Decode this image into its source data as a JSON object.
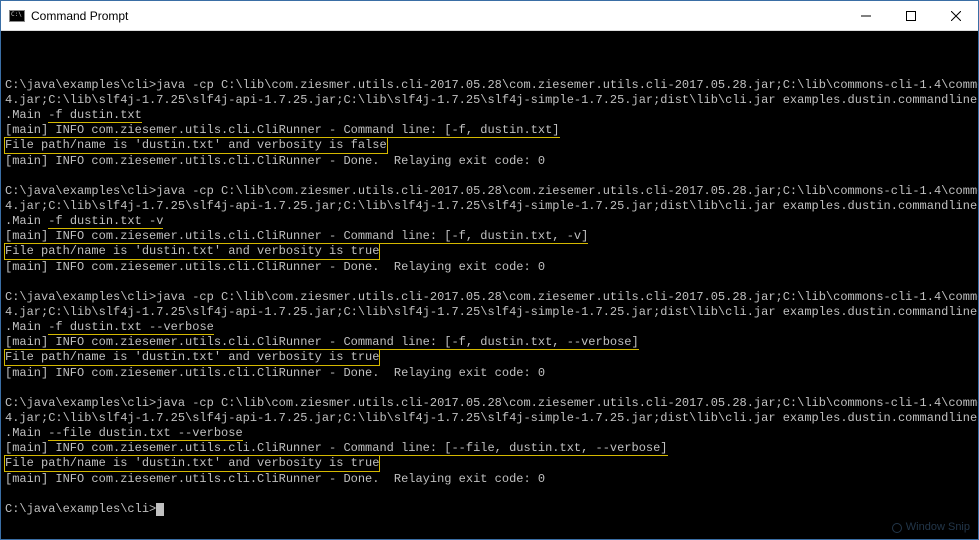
{
  "window": {
    "title": "Command Prompt",
    "icon_text": "C:\\"
  },
  "blocks": [
    {
      "prompt": "C:\\java\\examples\\cli>",
      "cmd_prefix": "java -cp C:\\lib\\com.ziesmer.utils.cli-2017.05.28\\com.ziesemer.utils.cli-2017.05.28.jar;C:\\lib\\commons-cli-1.4\\commons-cli-1.4.jar;C:\\lib\\slf4j-1.7.25\\slf4j-api-1.7.25.jar;C:\\lib\\slf4j-1.7.25\\slf4j-simple-1.7.25.jar;dist\\lib\\cli.jar examples.dustin.commandline.markutils.Main ",
      "cmd_args": "-f dustin.txt",
      "out_line1": "[main] INFO com.ziesemer.utils.cli.CliRunner - Command line: [-f, dustin.txt]",
      "out_highlight": "File path/name is 'dustin.txt' and verbosity is false",
      "out_line2": "[main] INFO com.ziesemer.utils.cli.CliRunner - Done.  Relaying exit code: 0"
    },
    {
      "prompt": "C:\\java\\examples\\cli>",
      "cmd_prefix": "java -cp C:\\lib\\com.ziesmer.utils.cli-2017.05.28\\com.ziesemer.utils.cli-2017.05.28.jar;C:\\lib\\commons-cli-1.4\\commons-cli-1.4.jar;C:\\lib\\slf4j-1.7.25\\slf4j-api-1.7.25.jar;C:\\lib\\slf4j-1.7.25\\slf4j-simple-1.7.25.jar;dist\\lib\\cli.jar examples.dustin.commandline.markutils.Main ",
      "cmd_args": "-f dustin.txt -v",
      "out_line1": "[main] INFO com.ziesemer.utils.cli.CliRunner - Command line: [-f, dustin.txt, -v]",
      "out_highlight": "File path/name is 'dustin.txt' and verbosity is true",
      "out_line2": "[main] INFO com.ziesemer.utils.cli.CliRunner - Done.  Relaying exit code: 0"
    },
    {
      "prompt": "C:\\java\\examples\\cli>",
      "cmd_prefix": "java -cp C:\\lib\\com.ziesmer.utils.cli-2017.05.28\\com.ziesemer.utils.cli-2017.05.28.jar;C:\\lib\\commons-cli-1.4\\commons-cli-1.4.jar;C:\\lib\\slf4j-1.7.25\\slf4j-api-1.7.25.jar;C:\\lib\\slf4j-1.7.25\\slf4j-simple-1.7.25.jar;dist\\lib\\cli.jar examples.dustin.commandline.markutils.Main ",
      "cmd_args": "-f dustin.txt --verbose",
      "out_line1": "[main] INFO com.ziesemer.utils.cli.CliRunner - Command line: [-f, dustin.txt, --verbose]",
      "out_highlight": "File path/name is 'dustin.txt' and verbosity is true",
      "out_line2": "[main] INFO com.ziesemer.utils.cli.CliRunner - Done.  Relaying exit code: 0"
    },
    {
      "prompt": "C:\\java\\examples\\cli>",
      "cmd_prefix": "java -cp C:\\lib\\com.ziesmer.utils.cli-2017.05.28\\com.ziesemer.utils.cli-2017.05.28.jar;C:\\lib\\commons-cli-1.4\\commons-cli-1.4.jar;C:\\lib\\slf4j-1.7.25\\slf4j-api-1.7.25.jar;C:\\lib\\slf4j-1.7.25\\slf4j-simple-1.7.25.jar;dist\\lib\\cli.jar examples.dustin.commandline.markutils.Main ",
      "cmd_args": "--file dustin.txt --verbose",
      "out_line1": "[main] INFO com.ziesemer.utils.cli.CliRunner - Command line: [--file, dustin.txt, --verbose]",
      "out_highlight": "File path/name is 'dustin.txt' and verbosity is true",
      "out_line2": "[main] INFO com.ziesemer.utils.cli.CliRunner - Done.  Relaying exit code: 0"
    }
  ],
  "final_prompt": "C:\\java\\examples\\cli>",
  "snip_label": "Window Snip"
}
